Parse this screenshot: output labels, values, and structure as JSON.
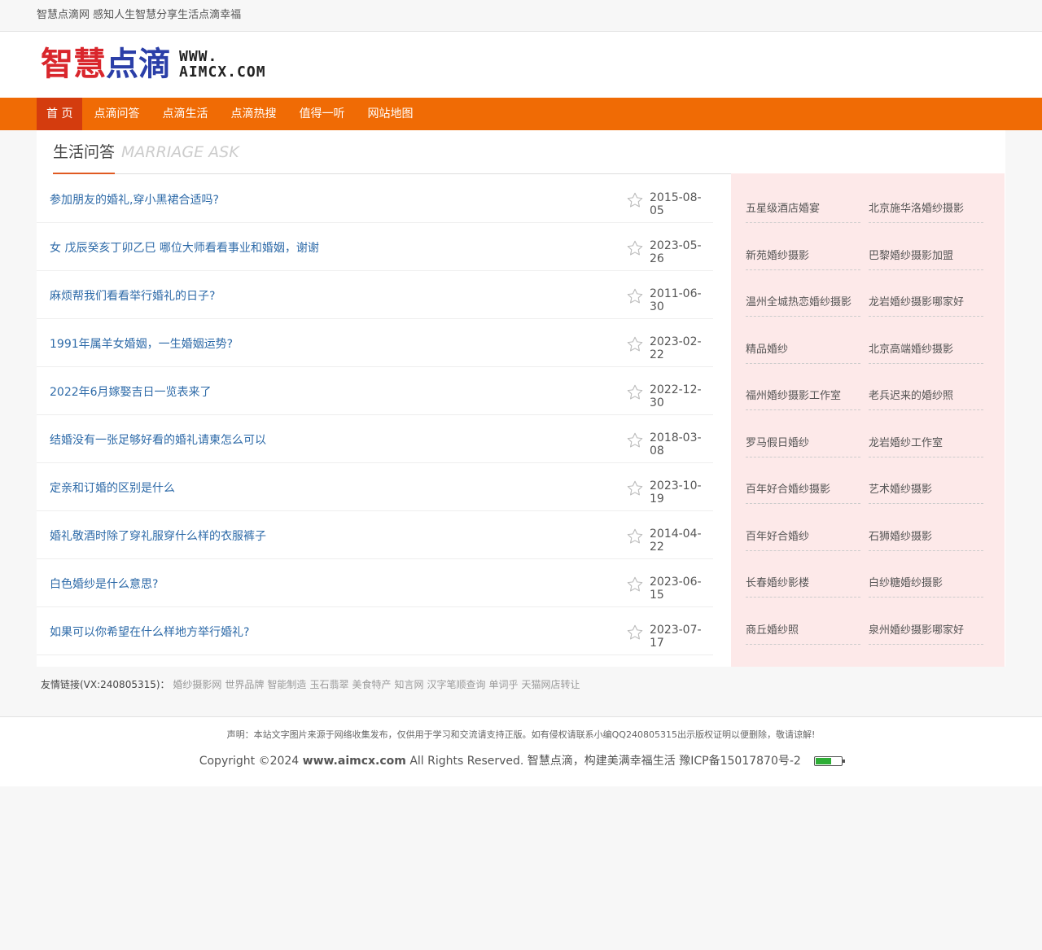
{
  "topbar": {
    "slogan": "智慧点滴网 感知人生智慧分享生活点滴幸福"
  },
  "logo": {
    "cn_part1": "智慧",
    "cn_part2": "点滴",
    "en_line1": "WWW.",
    "en_line2": "AIMCX.COM",
    "color_red": "#d9262c",
    "color_blue": "#2b3fa8"
  },
  "nav": {
    "accent": "#f06b05",
    "items": [
      {
        "label": "首 页",
        "active": true
      },
      {
        "label": "点滴问答"
      },
      {
        "label": "点滴生活"
      },
      {
        "label": "点滴热搜"
      },
      {
        "label": "值得一听"
      },
      {
        "label": "网站地图"
      }
    ]
  },
  "section": {
    "title": "生活问答",
    "subtitle": "MARRIAGE ASK"
  },
  "articles": [
    {
      "title": "参加朋友的婚礼,穿小黑裙合适吗?",
      "date": "2015-08-05"
    },
    {
      "title": "女 戊辰癸亥丁卯乙巳 哪位大师看看事业和婚姻，谢谢",
      "date": "2023-05-26"
    },
    {
      "title": "麻烦帮我们看看举行婚礼的日子?",
      "date": "2011-06-30"
    },
    {
      "title": "1991年属羊女婚姻，一生婚姻运势?",
      "date": "2023-02-22"
    },
    {
      "title": "2022年6月嫁娶吉日一览表来了",
      "date": "2022-12-30"
    },
    {
      "title": "结婚没有一张足够好看的婚礼请柬怎么可以",
      "date": "2018-03-08"
    },
    {
      "title": "定亲和订婚的区别是什么",
      "date": "2023-10-19"
    },
    {
      "title": "婚礼敬酒时除了穿礼服穿什么样的衣服裤子",
      "date": "2014-04-22"
    },
    {
      "title": "白色婚纱是什么意思?",
      "date": "2023-06-15"
    },
    {
      "title": "如果可以你希望在什么样地方举行婚礼?",
      "date": "2023-07-17"
    }
  ],
  "sidebar": {
    "tags": [
      "五星级酒店婚宴",
      "北京施华洛婚纱摄影",
      "新苑婚纱摄影",
      "巴黎婚纱摄影加盟",
      "温州全城热恋婚纱摄影",
      "龙岩婚纱摄影哪家好",
      "精品婚纱",
      "北京高端婚纱摄影",
      "福州婚纱摄影工作室",
      "老兵迟来的婚纱照",
      "罗马假日婚纱",
      "龙岩婚纱工作室",
      "百年好合婚纱摄影",
      "艺术婚纱摄影",
      "百年好合婚纱",
      "石狮婚纱摄影",
      "长春婚纱影楼",
      "白纱糖婚纱摄影",
      "商丘婚纱照",
      "泉州婚纱摄影哪家好"
    ]
  },
  "links": {
    "label": "友情链接(VX:240805315)：",
    "items": [
      "婚纱摄影网",
      "世界品牌",
      "智能制造",
      "玉石翡翠",
      "美食特产",
      "知言网",
      "汉字笔顺查询",
      "单词乎",
      "天猫网店转让"
    ]
  },
  "footer": {
    "notice": "声明：本站文字图片来源于网络收集发布，仅供用于学习和交流请支持正版。如有侵权请联系小编QQ240805315出示版权证明以便删除，敬请谅解!",
    "copy_prefix": "Copyright ©2024 ",
    "domain": "www.aimcx.com",
    "copy_suffix": " All Rights Reserved. 智慧点滴，构建美满幸福生活 豫ICP备15017870号-2"
  }
}
